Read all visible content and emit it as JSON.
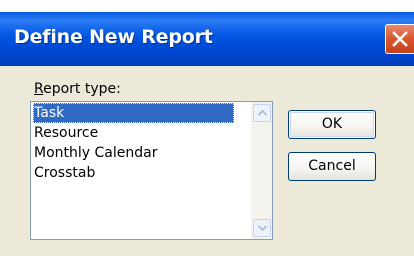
{
  "window": {
    "title": "Define New Report"
  },
  "report_type": {
    "label_prefix": "",
    "label_underlined": "R",
    "label_rest": "eport type:",
    "items": [
      {
        "label": "Task",
        "selected": true
      },
      {
        "label": "Resource",
        "selected": false
      },
      {
        "label": "Monthly Calendar",
        "selected": false
      },
      {
        "label": "Crosstab",
        "selected": false
      }
    ]
  },
  "buttons": {
    "ok": "OK",
    "cancel": "Cancel"
  },
  "icons": {
    "close": "close-icon",
    "scroll_up": "scroll-up-arrow-icon",
    "scroll_down": "scroll-down-arrow-icon"
  },
  "colors": {
    "titlebar": "#0055e3",
    "selection": "#316ac5",
    "close": "#d9552e"
  }
}
